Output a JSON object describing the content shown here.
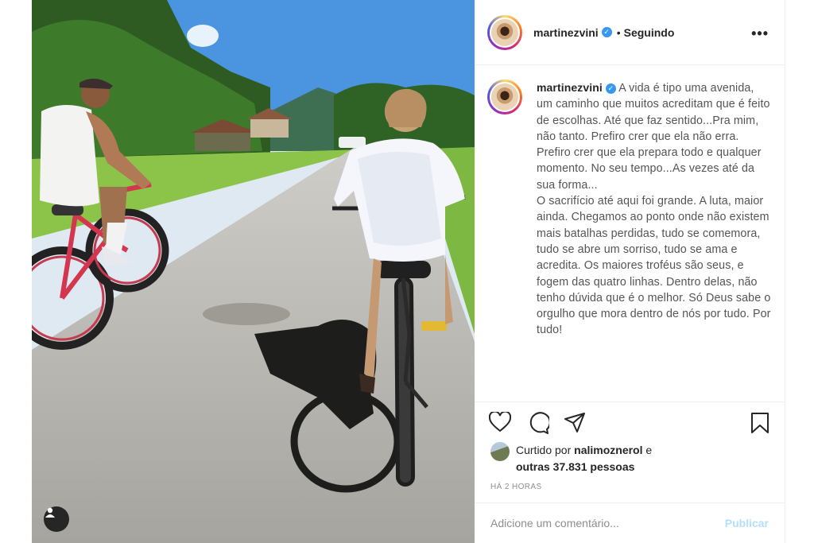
{
  "header": {
    "username": "martinezvini",
    "separator": "•",
    "follow_status": "Seguindo",
    "more_label": "•••"
  },
  "caption": {
    "username": "martinezvini",
    "text": "A vida é tipo uma avenida, um caminho que muitos acreditam que é feito de escolhas. Até que faz sentido...Pra mim, não tanto. Prefiro crer que ela não erra. Prefiro crer que ela prepara todo e qualquer momento. No seu tempo...As vezes até da sua forma...\nO sacrifício até aqui foi grande. A luta, maior ainda. Chegamos ao ponto onde não existem mais batalhas perdidas, tudo se comemora, tudo se abre um sorriso, tudo se ama e acredita. Os maiores troféus são seus, e fogem das quatro linhas. Dentro delas, não tenho dúvida que é o melhor. Só Deus sabe o orgulho que mora dentro de nós por tudo. Por tudo!"
  },
  "likes": {
    "prefix": "Curtido por",
    "liker": "nalimoznerol",
    "conj": "e",
    "others": "outras 37.831 pessoas"
  },
  "timestamp": "HÁ 2 HORAS",
  "comment": {
    "placeholder": "Adicione um comentário...",
    "publish_label": "Publicar"
  },
  "icons": [
    "heart-icon",
    "comment-icon",
    "share-icon",
    "bookmark-icon",
    "more-icon",
    "verified-icon",
    "user-tag-icon"
  ],
  "colors": {
    "verified": "#3897f0",
    "publish": "#b2dffc",
    "muted": "#8e8e8e"
  }
}
